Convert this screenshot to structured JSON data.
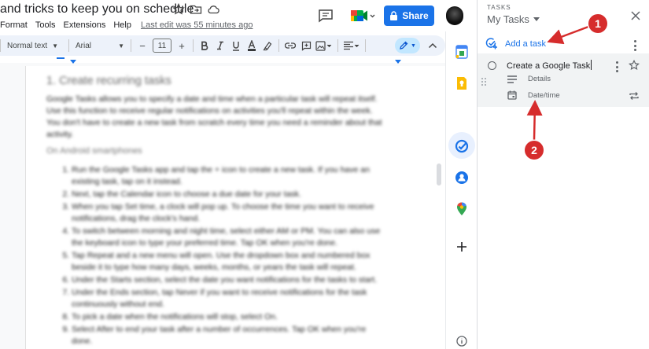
{
  "docs": {
    "title": "and tricks to keep you on schedule",
    "menu": [
      "Format",
      "Tools",
      "Extensions",
      "Help"
    ],
    "last_edit": "Last edit was 55 minutes ago",
    "share_label": "Share",
    "toolbar": {
      "style": "Normal text",
      "font": "Arial",
      "font_size": "11",
      "minus": "−",
      "plus": "+"
    },
    "content": {
      "heading": "1. Create recurring tasks",
      "intro": "Google Tasks allows you to specify a date and time when a particular task will repeat itself. Use this function to receive regular notifications on activities you'll repeat within the week. You don't have to create a new task from scratch every time you need a reminder about that activity.",
      "subheading": "On Android smartphones",
      "steps": [
        "Run the Google Tasks app and tap the + icon to create a new task. If you have an existing task, tap on it instead.",
        "Next, tap the Calendar icon to choose a due date for your task.",
        "When you tap Set time, a clock will pop up. To choose the time you want to receive notifications, drag the clock's hand.",
        "To switch between morning and night time, select either AM or PM. You can also use the keyboard icon to type your preferred time. Tap OK when you're done.",
        "Tap Repeat and a new menu will open. Use the dropdown box and numbered box beside it to type how many days, weeks, months, or years the task will repeat.",
        "Under the Starts section, select the date you want notifications for the tasks to start.",
        "Under the Ends section, tap Never if you want to receive notifications for the task continuously without end.",
        "To pick a date when the notifications will stop, select On.",
        "Select After to end your task after a number of occurrences. Tap OK when you're done."
      ]
    }
  },
  "tasks_panel": {
    "kicker": "TASKS",
    "list_name": "My Tasks",
    "add_task_label": "Add a task",
    "task": {
      "title": "Create a Google Task",
      "details_label": "Details",
      "datetime_label": "Date/time"
    }
  },
  "annotations": {
    "badge_1": "1",
    "badge_2": "2",
    "color": "#d62c2c"
  },
  "colors": {
    "accent": "#1a73e8",
    "toolbar_bg": "#edf2fa",
    "task_bg": "#f1f3f4"
  }
}
